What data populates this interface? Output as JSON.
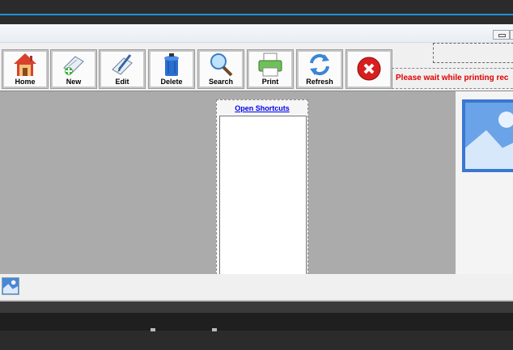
{
  "toolbar": {
    "buttons": [
      {
        "label": "Home",
        "icon": "house-icon"
      },
      {
        "label": "New",
        "icon": "new-document-icon"
      },
      {
        "label": "Edit",
        "icon": "edit-pencil-icon"
      },
      {
        "label": "Delete",
        "icon": "trash-bin-icon"
      },
      {
        "label": "Search",
        "icon": "magnifier-icon"
      },
      {
        "label": "Print",
        "icon": "printer-icon"
      },
      {
        "label": "Refresh",
        "icon": "refresh-arrows-icon"
      },
      {
        "label": "",
        "icon": "close-red-icon"
      }
    ]
  },
  "status": {
    "message": "Please wait while printing rec",
    "color": "#e00000"
  },
  "shortcuts": {
    "title": "Open Shortcuts"
  },
  "colors": {
    "accent": "#1e90d6",
    "content_bg": "#ababab"
  }
}
